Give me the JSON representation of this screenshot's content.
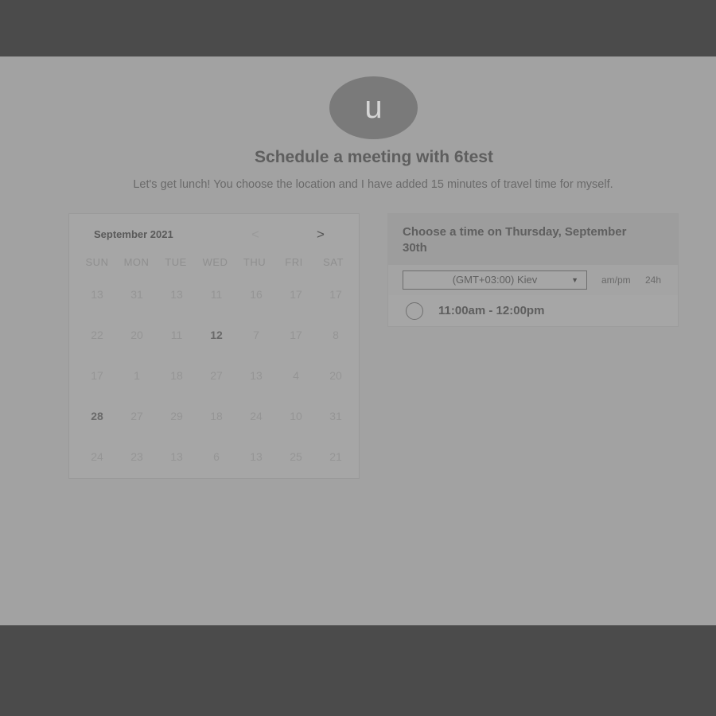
{
  "header": {
    "avatar_initial": "u",
    "title": "Schedule a meeting with 6test",
    "subtitle": "Let's get lunch! You choose the location and I have added 15 minutes of travel time for myself."
  },
  "calendar": {
    "month_label": "September 2021",
    "prev_icon": "<",
    "next_icon": ">",
    "weekdays": [
      "SUN",
      "MON",
      "TUE",
      "WED",
      "THU",
      "FRI",
      "SAT"
    ],
    "weeks": [
      [
        "13",
        "31",
        "13",
        "11",
        "16",
        "17",
        "17"
      ],
      [
        "22",
        "20",
        "11",
        "12",
        "7",
        "17",
        "8"
      ],
      [
        "17",
        "1",
        "18",
        "27",
        "13",
        "4",
        "20"
      ],
      [
        "28",
        "27",
        "29",
        "18",
        "24",
        "10",
        "31"
      ],
      [
        "24",
        "23",
        "13",
        "6",
        "13",
        "25",
        "21"
      ]
    ],
    "strong_days": [
      [
        1,
        3
      ],
      [
        3,
        0
      ]
    ]
  },
  "times": {
    "title": "Choose a time on Thursday, September 30th",
    "timezone": "(GMT+03:00) Kiev",
    "format_ampm": "am/pm",
    "format_24h": "24h",
    "slots": [
      "11:00am - 12:00pm"
    ]
  }
}
